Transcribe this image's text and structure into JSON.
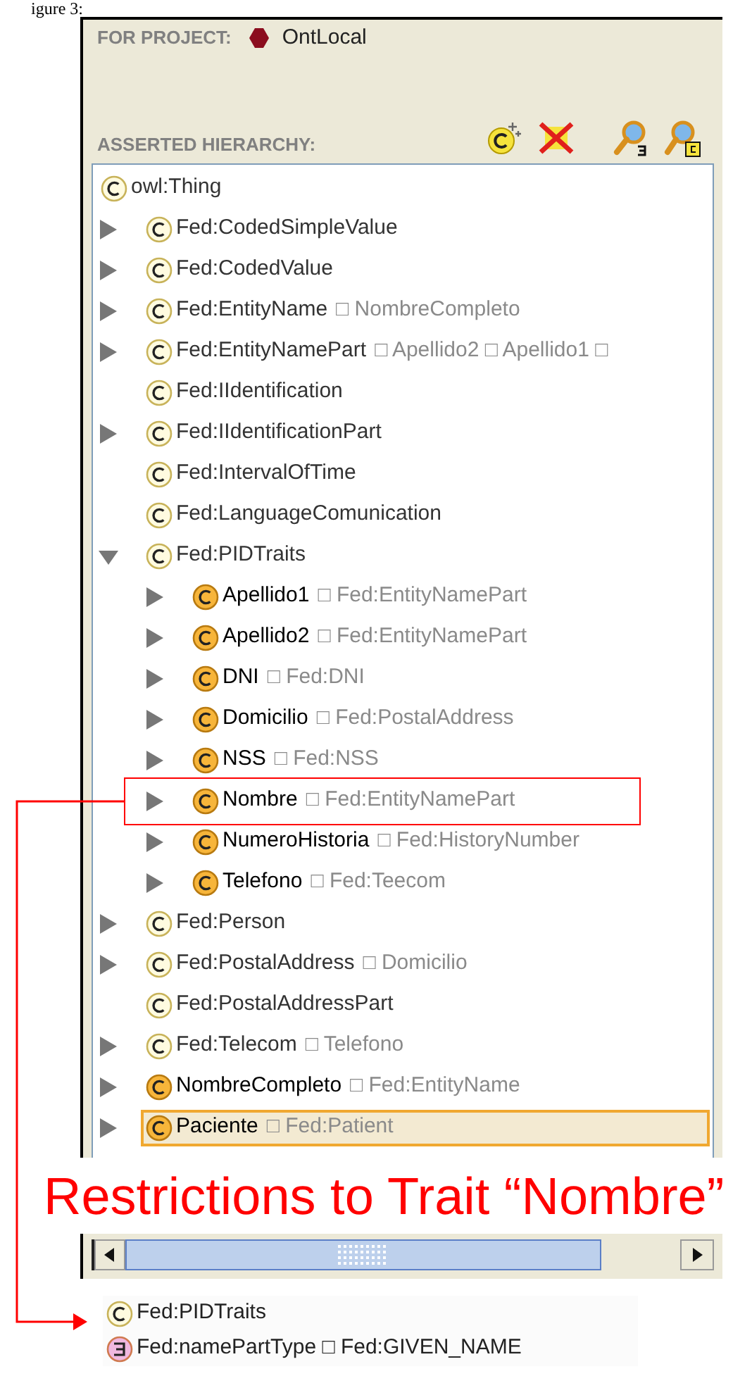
{
  "caption": "igure 3:",
  "project": {
    "label": "FOR PROJECT:",
    "name": "OntLocal"
  },
  "hierarchy": {
    "label": "ASSERTED HIERARCHY:"
  },
  "tree": [
    {
      "label": "owl:Thing",
      "kind": "class",
      "children": [
        {
          "label": "Fed:CodedSimpleValue",
          "kind": "class",
          "expanded": false
        },
        {
          "label": "Fed:CodedValue",
          "kind": "class",
          "expanded": false
        },
        {
          "label": "Fed:EntityName",
          "detail": "□ NombreCompleto",
          "kind": "class",
          "expanded": false
        },
        {
          "label": "Fed:EntityNamePart",
          "detail": "□ Apellido2 □ Apellido1 □",
          "kind": "class",
          "expanded": false
        },
        {
          "label": "Fed:IIdentification",
          "kind": "class"
        },
        {
          "label": "Fed:IIdentificationPart",
          "kind": "class",
          "expanded": false
        },
        {
          "label": "Fed:IntervalOfTime",
          "kind": "class"
        },
        {
          "label": "Fed:LanguageComunication",
          "kind": "class"
        },
        {
          "label": "Fed:PIDTraits",
          "kind": "class",
          "expanded": true,
          "children": [
            {
              "label": "Apellido1",
              "detail": "□ Fed:EntityNamePart",
              "kind": "defined",
              "expanded": false
            },
            {
              "label": "Apellido2",
              "detail": "□ Fed:EntityNamePart",
              "kind": "defined",
              "expanded": false
            },
            {
              "label": "DNI",
              "detail": "□ Fed:DNI",
              "kind": "defined",
              "expanded": false
            },
            {
              "label": "Domicilio",
              "detail": "□ Fed:PostalAddress",
              "kind": "defined",
              "expanded": false
            },
            {
              "label": "NSS",
              "detail": "□ Fed:NSS",
              "kind": "defined",
              "expanded": false
            },
            {
              "label": "Nombre",
              "detail": "□ Fed:EntityNamePart",
              "kind": "defined",
              "expanded": false,
              "highlighted": true
            },
            {
              "label": "NumeroHistoria",
              "detail": "□ Fed:HistoryNumber",
              "kind": "defined",
              "expanded": false
            },
            {
              "label": "Telefono",
              "detail": "□ Fed:Teecom",
              "kind": "defined",
              "expanded": false
            }
          ]
        },
        {
          "label": "Fed:Person",
          "kind": "class",
          "expanded": false
        },
        {
          "label": "Fed:PostalAddress",
          "detail": "□ Domicilio",
          "kind": "class",
          "expanded": false
        },
        {
          "label": "Fed:PostalAddressPart",
          "kind": "class"
        },
        {
          "label": "Fed:Telecom",
          "detail": "□ Telefono",
          "kind": "class",
          "expanded": false
        },
        {
          "label": "NombreCompleto",
          "detail": "□ Fed:EntityName",
          "kind": "defined",
          "expanded": false
        },
        {
          "label": "Paciente",
          "detail": "□ Fed:Patient",
          "kind": "defined",
          "expanded": false,
          "selected": true
        }
      ]
    }
  ],
  "annotation": {
    "text": "Restrictions to Trait “Nombre”"
  },
  "restrictions": [
    {
      "label": "Fed:PIDTraits",
      "kind": "class"
    },
    {
      "label": "Fed:namePartType □ Fed:GIVEN_NAME",
      "kind": "restriction"
    }
  ]
}
